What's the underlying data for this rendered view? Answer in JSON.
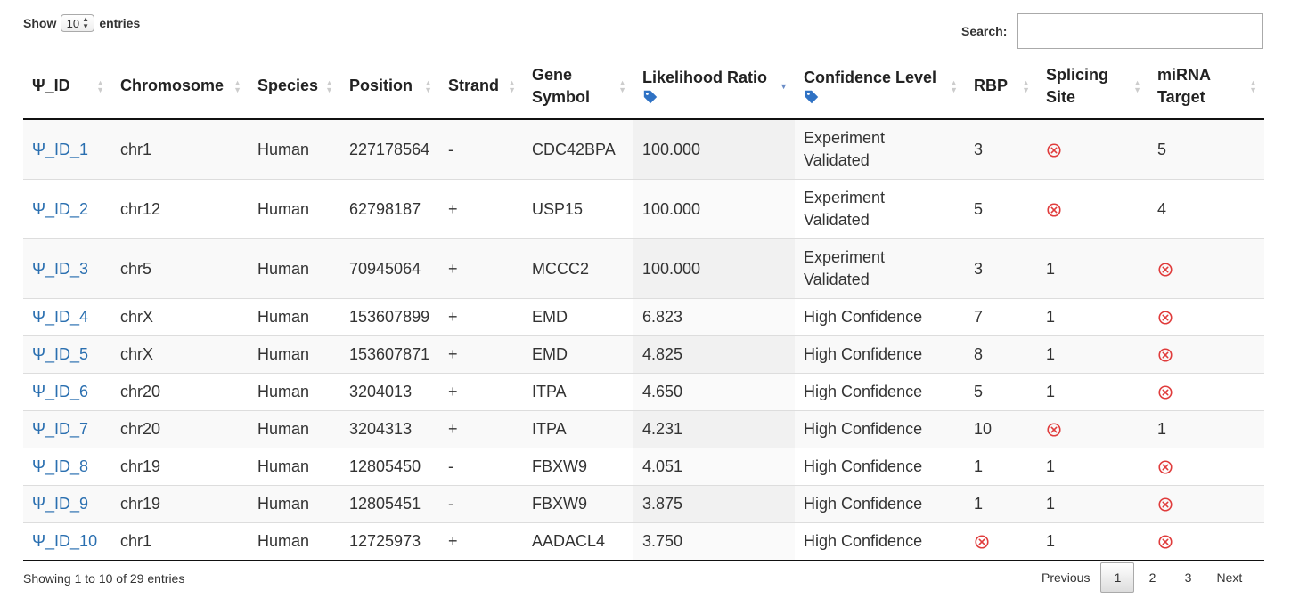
{
  "length_menu": {
    "prefix": "Show",
    "value": "10",
    "suffix": "entries"
  },
  "search": {
    "label": "Search:",
    "value": "",
    "placeholder": ""
  },
  "columns": [
    {
      "line1": "Ψ_ID",
      "line2": ""
    },
    {
      "line1": "Chromosome",
      "line2": ""
    },
    {
      "line1": "Species",
      "line2": ""
    },
    {
      "line1": "Position",
      "line2": ""
    },
    {
      "line1": "Strand",
      "line2": ""
    },
    {
      "line1": "Gene",
      "line2": "Symbol"
    },
    {
      "line1": "Likelihood Ratio",
      "line2": ""
    },
    {
      "line1": "Confidence Level",
      "line2": ""
    },
    {
      "line1": "RBP",
      "line2": ""
    },
    {
      "line1": "Splicing",
      "line2": "Site"
    },
    {
      "line1": "miRNA",
      "line2": "Target"
    }
  ],
  "rows": [
    {
      "id": "Ψ_ID_1",
      "chromosome": "chr1",
      "species": "Human",
      "position": "227178564",
      "strand": "-",
      "gene": "CDC42BPA",
      "likelihood": "100.000",
      "confidence_l1": "Experiment",
      "confidence_l2": "Validated",
      "rbp": "3",
      "splicing": "x",
      "mirna": "5"
    },
    {
      "id": "Ψ_ID_2",
      "chromosome": "chr12",
      "species": "Human",
      "position": "62798187",
      "strand": "+",
      "gene": "USP15",
      "likelihood": "100.000",
      "confidence_l1": "Experiment",
      "confidence_l2": "Validated",
      "rbp": "5",
      "splicing": "x",
      "mirna": "4"
    },
    {
      "id": "Ψ_ID_3",
      "chromosome": "chr5",
      "species": "Human",
      "position": "70945064",
      "strand": "+",
      "gene": "MCCC2",
      "likelihood": "100.000",
      "confidence_l1": "Experiment",
      "confidence_l2": "Validated",
      "rbp": "3",
      "splicing": "1",
      "mirna": "x"
    },
    {
      "id": "Ψ_ID_4",
      "chromosome": "chrX",
      "species": "Human",
      "position": "153607899",
      "strand": "+",
      "gene": "EMD",
      "likelihood": "6.823",
      "confidence_l1": "High Confidence",
      "confidence_l2": "",
      "rbp": "7",
      "splicing": "1",
      "mirna": "x"
    },
    {
      "id": "Ψ_ID_5",
      "chromosome": "chrX",
      "species": "Human",
      "position": "153607871",
      "strand": "+",
      "gene": "EMD",
      "likelihood": "4.825",
      "confidence_l1": "High Confidence",
      "confidence_l2": "",
      "rbp": "8",
      "splicing": "1",
      "mirna": "x"
    },
    {
      "id": "Ψ_ID_6",
      "chromosome": "chr20",
      "species": "Human",
      "position": "3204013",
      "strand": "+",
      "gene": "ITPA",
      "likelihood": "4.650",
      "confidence_l1": "High Confidence",
      "confidence_l2": "",
      "rbp": "5",
      "splicing": "1",
      "mirna": "x"
    },
    {
      "id": "Ψ_ID_7",
      "chromosome": "chr20",
      "species": "Human",
      "position": "3204313",
      "strand": "+",
      "gene": "ITPA",
      "likelihood": "4.231",
      "confidence_l1": "High Confidence",
      "confidence_l2": "",
      "rbp": "10",
      "splicing": "x",
      "mirna": "1"
    },
    {
      "id": "Ψ_ID_8",
      "chromosome": "chr19",
      "species": "Human",
      "position": "12805450",
      "strand": "-",
      "gene": "FBXW9",
      "likelihood": "4.051",
      "confidence_l1": "High Confidence",
      "confidence_l2": "",
      "rbp": "1",
      "splicing": "1",
      "mirna": "x"
    },
    {
      "id": "Ψ_ID_9",
      "chromosome": "chr19",
      "species": "Human",
      "position": "12805451",
      "strand": "-",
      "gene": "FBXW9",
      "likelihood": "3.875",
      "confidence_l1": "High Confidence",
      "confidence_l2": "",
      "rbp": "1",
      "splicing": "1",
      "mirna": "x"
    },
    {
      "id": "Ψ_ID_10",
      "chromosome": "chr1",
      "species": "Human",
      "position": "12725973",
      "strand": "+",
      "gene": "AADACL4",
      "likelihood": "3.750",
      "confidence_l1": "High Confidence",
      "confidence_l2": "",
      "rbp": "x",
      "splicing": "1",
      "mirna": "x"
    }
  ],
  "info": "Showing 1 to 10 of 29 entries",
  "pagination": {
    "previous": "Previous",
    "pages": [
      "1",
      "2",
      "3"
    ],
    "current": "1",
    "next": "Next"
  },
  "colors": {
    "link": "#2a6fb0",
    "tag_icon": "#2f72c4",
    "x_icon": "#e03c3c",
    "sort_active": "#6a8cc7"
  },
  "icons": {
    "cell_x": "circle-x-icon",
    "header_tag": "tag-icon",
    "sort": "sort-arrows-icon"
  }
}
